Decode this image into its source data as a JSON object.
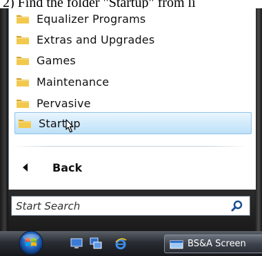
{
  "caption": "2) Find the folder \"Startup\" from li",
  "menu": {
    "items": [
      {
        "label": "Equalizer Programs",
        "icon": "folder-icon"
      },
      {
        "label": "Extras and Upgrades",
        "icon": "folder-icon"
      },
      {
        "label": "Games",
        "icon": "folder-icon"
      },
      {
        "label": "Maintenance",
        "icon": "folder-icon"
      },
      {
        "label": "Pervasive",
        "icon": "folder-icon"
      },
      {
        "label": "Startup",
        "icon": "folder-icon",
        "selected": true
      }
    ],
    "back_label": "Back"
  },
  "search": {
    "placeholder": "Start Search",
    "icon": "search-icon"
  },
  "taskbar": {
    "start_icon": "windows-start-orb-icon",
    "quick_launch": [
      "show-desktop-icon",
      "switch-windows-icon",
      "internet-explorer-icon"
    ],
    "task_button_label": "BS&A Screen",
    "task_button_icon": "app-window-icon"
  },
  "colors": {
    "selection": "#cfe8fb",
    "taskbar": "#1f2227",
    "folder": "#e8b93a"
  }
}
